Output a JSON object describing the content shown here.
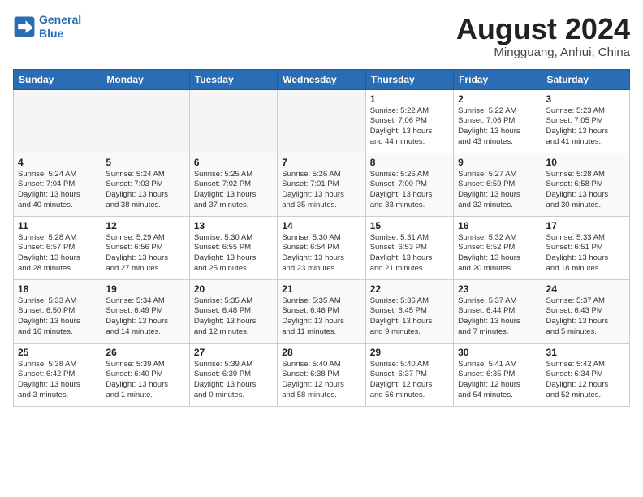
{
  "header": {
    "logo_line1": "General",
    "logo_line2": "Blue",
    "title": "August 2024",
    "subtitle": "Mingguang, Anhui, China"
  },
  "weekdays": [
    "Sunday",
    "Monday",
    "Tuesday",
    "Wednesday",
    "Thursday",
    "Friday",
    "Saturday"
  ],
  "weeks": [
    [
      {
        "day": "",
        "info": "",
        "empty": true
      },
      {
        "day": "",
        "info": "",
        "empty": true
      },
      {
        "day": "",
        "info": "",
        "empty": true
      },
      {
        "day": "",
        "info": "",
        "empty": true
      },
      {
        "day": "1",
        "info": "Sunrise: 5:22 AM\nSunset: 7:06 PM\nDaylight: 13 hours\nand 44 minutes."
      },
      {
        "day": "2",
        "info": "Sunrise: 5:22 AM\nSunset: 7:06 PM\nDaylight: 13 hours\nand 43 minutes."
      },
      {
        "day": "3",
        "info": "Sunrise: 5:23 AM\nSunset: 7:05 PM\nDaylight: 13 hours\nand 41 minutes."
      }
    ],
    [
      {
        "day": "4",
        "info": "Sunrise: 5:24 AM\nSunset: 7:04 PM\nDaylight: 13 hours\nand 40 minutes."
      },
      {
        "day": "5",
        "info": "Sunrise: 5:24 AM\nSunset: 7:03 PM\nDaylight: 13 hours\nand 38 minutes."
      },
      {
        "day": "6",
        "info": "Sunrise: 5:25 AM\nSunset: 7:02 PM\nDaylight: 13 hours\nand 37 minutes."
      },
      {
        "day": "7",
        "info": "Sunrise: 5:26 AM\nSunset: 7:01 PM\nDaylight: 13 hours\nand 35 minutes."
      },
      {
        "day": "8",
        "info": "Sunrise: 5:26 AM\nSunset: 7:00 PM\nDaylight: 13 hours\nand 33 minutes."
      },
      {
        "day": "9",
        "info": "Sunrise: 5:27 AM\nSunset: 6:59 PM\nDaylight: 13 hours\nand 32 minutes."
      },
      {
        "day": "10",
        "info": "Sunrise: 5:28 AM\nSunset: 6:58 PM\nDaylight: 13 hours\nand 30 minutes."
      }
    ],
    [
      {
        "day": "11",
        "info": "Sunrise: 5:28 AM\nSunset: 6:57 PM\nDaylight: 13 hours\nand 28 minutes."
      },
      {
        "day": "12",
        "info": "Sunrise: 5:29 AM\nSunset: 6:56 PM\nDaylight: 13 hours\nand 27 minutes."
      },
      {
        "day": "13",
        "info": "Sunrise: 5:30 AM\nSunset: 6:55 PM\nDaylight: 13 hours\nand 25 minutes."
      },
      {
        "day": "14",
        "info": "Sunrise: 5:30 AM\nSunset: 6:54 PM\nDaylight: 13 hours\nand 23 minutes."
      },
      {
        "day": "15",
        "info": "Sunrise: 5:31 AM\nSunset: 6:53 PM\nDaylight: 13 hours\nand 21 minutes."
      },
      {
        "day": "16",
        "info": "Sunrise: 5:32 AM\nSunset: 6:52 PM\nDaylight: 13 hours\nand 20 minutes."
      },
      {
        "day": "17",
        "info": "Sunrise: 5:33 AM\nSunset: 6:51 PM\nDaylight: 13 hours\nand 18 minutes."
      }
    ],
    [
      {
        "day": "18",
        "info": "Sunrise: 5:33 AM\nSunset: 6:50 PM\nDaylight: 13 hours\nand 16 minutes."
      },
      {
        "day": "19",
        "info": "Sunrise: 5:34 AM\nSunset: 6:49 PM\nDaylight: 13 hours\nand 14 minutes."
      },
      {
        "day": "20",
        "info": "Sunrise: 5:35 AM\nSunset: 6:48 PM\nDaylight: 13 hours\nand 12 minutes."
      },
      {
        "day": "21",
        "info": "Sunrise: 5:35 AM\nSunset: 6:46 PM\nDaylight: 13 hours\nand 11 minutes."
      },
      {
        "day": "22",
        "info": "Sunrise: 5:36 AM\nSunset: 6:45 PM\nDaylight: 13 hours\nand 9 minutes."
      },
      {
        "day": "23",
        "info": "Sunrise: 5:37 AM\nSunset: 6:44 PM\nDaylight: 13 hours\nand 7 minutes."
      },
      {
        "day": "24",
        "info": "Sunrise: 5:37 AM\nSunset: 6:43 PM\nDaylight: 13 hours\nand 5 minutes."
      }
    ],
    [
      {
        "day": "25",
        "info": "Sunrise: 5:38 AM\nSunset: 6:42 PM\nDaylight: 13 hours\nand 3 minutes."
      },
      {
        "day": "26",
        "info": "Sunrise: 5:39 AM\nSunset: 6:40 PM\nDaylight: 13 hours\nand 1 minute."
      },
      {
        "day": "27",
        "info": "Sunrise: 5:39 AM\nSunset: 6:39 PM\nDaylight: 13 hours\nand 0 minutes."
      },
      {
        "day": "28",
        "info": "Sunrise: 5:40 AM\nSunset: 6:38 PM\nDaylight: 12 hours\nand 58 minutes."
      },
      {
        "day": "29",
        "info": "Sunrise: 5:40 AM\nSunset: 6:37 PM\nDaylight: 12 hours\nand 56 minutes."
      },
      {
        "day": "30",
        "info": "Sunrise: 5:41 AM\nSunset: 6:35 PM\nDaylight: 12 hours\nand 54 minutes."
      },
      {
        "day": "31",
        "info": "Sunrise: 5:42 AM\nSunset: 6:34 PM\nDaylight: 12 hours\nand 52 minutes."
      }
    ]
  ]
}
